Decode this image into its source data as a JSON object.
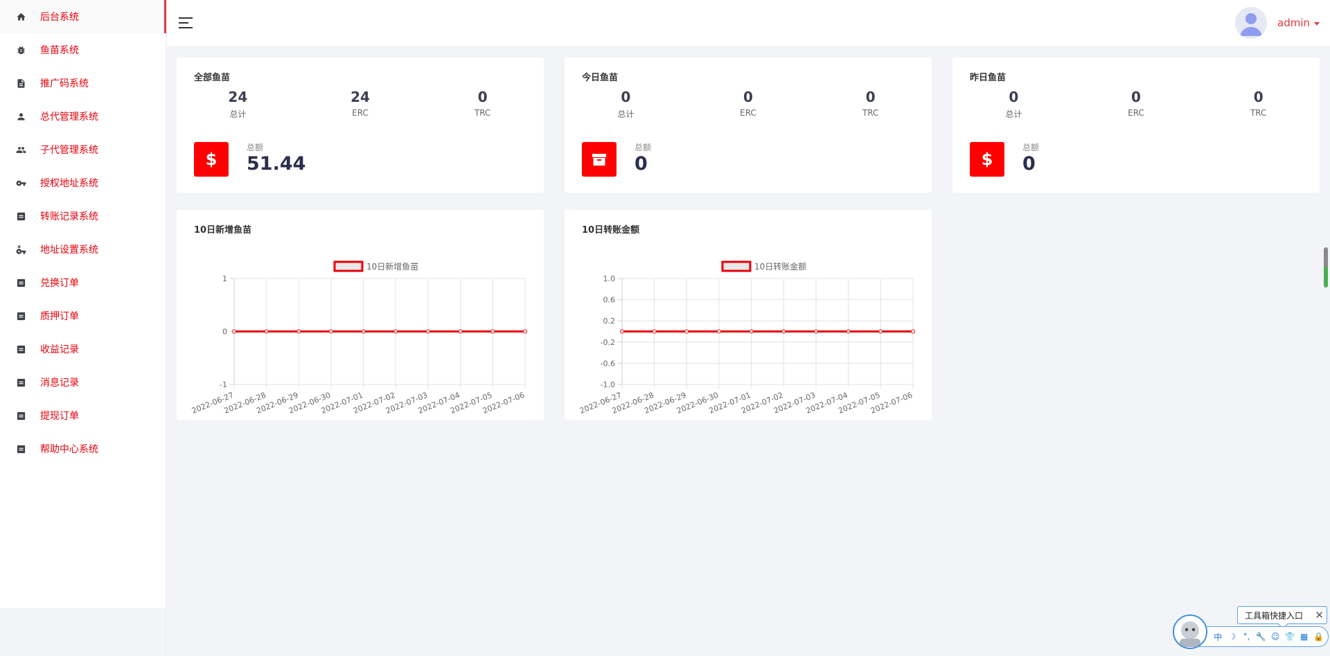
{
  "sidebar": {
    "items": [
      {
        "label": "后台系统",
        "icon": "home-icon"
      },
      {
        "label": "鱼苗系统",
        "icon": "bug-icon"
      },
      {
        "label": "推广码系统",
        "icon": "document-icon"
      },
      {
        "label": "总代管理系统",
        "icon": "user-icon"
      },
      {
        "label": "子代管理系统",
        "icon": "users-icon"
      },
      {
        "label": "授权地址系统",
        "icon": "key-icon"
      },
      {
        "label": "转账记录系统",
        "icon": "list-icon"
      },
      {
        "label": "地址设置系统",
        "icon": "key-remove-icon"
      },
      {
        "label": "兑换订单",
        "icon": "list-icon"
      },
      {
        "label": "质押订单",
        "icon": "list-icon"
      },
      {
        "label": "收益记录",
        "icon": "list-icon"
      },
      {
        "label": "消息记录",
        "icon": "list-icon"
      },
      {
        "label": "提现订单",
        "icon": "list-icon"
      },
      {
        "label": "帮助中心系统",
        "icon": "list-icon"
      }
    ]
  },
  "header": {
    "username": "admin"
  },
  "summary_cards": [
    {
      "title": "全部鱼苗",
      "stats": [
        {
          "value": "24",
          "label": "总计"
        },
        {
          "value": "24",
          "label": "ERC"
        },
        {
          "value": "0",
          "label": "TRC"
        }
      ],
      "total_label": "总额",
      "total_value": "51.44",
      "icon": "dollar-icon"
    },
    {
      "title": "今日鱼苗",
      "stats": [
        {
          "value": "0",
          "label": "总计"
        },
        {
          "value": "0",
          "label": "ERC"
        },
        {
          "value": "0",
          "label": "TRC"
        }
      ],
      "total_label": "总额",
      "total_value": "0",
      "icon": "archive-icon"
    },
    {
      "title": "昨日鱼苗",
      "stats": [
        {
          "value": "0",
          "label": "总计"
        },
        {
          "value": "0",
          "label": "ERC"
        },
        {
          "value": "0",
          "label": "TRC"
        }
      ],
      "total_label": "总额",
      "total_value": "0",
      "icon": "dollar-icon"
    }
  ],
  "chart_cards": [
    {
      "title": "10日新增鱼苗"
    },
    {
      "title": "10日转账金额"
    }
  ],
  "chart_data": [
    {
      "type": "line",
      "title": "10日新增鱼苗",
      "x": [
        "2022-06-27",
        "2022-06-28",
        "2022-06-29",
        "2022-06-30",
        "2022-07-01",
        "2022-07-02",
        "2022-07-03",
        "2022-07-04",
        "2022-07-05",
        "2022-07-06"
      ],
      "series": [
        {
          "name": "10日新增鱼苗",
          "values": [
            0,
            0,
            0,
            0,
            0,
            0,
            0,
            0,
            0,
            0
          ]
        }
      ],
      "yticks": [
        "1",
        "0",
        "-1"
      ],
      "ylim": [
        -1,
        1
      ],
      "grid": true,
      "legend": "top-center",
      "color": "#e8000b"
    },
    {
      "type": "line",
      "title": "10日转账金额",
      "x": [
        "2022-06-27",
        "2022-06-28",
        "2022-06-29",
        "2022-06-30",
        "2022-07-01",
        "2022-07-02",
        "2022-07-03",
        "2022-07-04",
        "2022-07-05",
        "2022-07-06"
      ],
      "series": [
        {
          "name": "10日转账金额",
          "values": [
            0,
            0,
            0,
            0,
            0,
            0,
            0,
            0,
            0,
            0
          ]
        }
      ],
      "yticks": [
        "1.0",
        "0.6",
        "0.2",
        "-0.2",
        "-0.6",
        "-1.0"
      ],
      "ylim": [
        -1,
        1
      ],
      "grid": true,
      "legend": "top-center",
      "color": "#e8000b"
    }
  ],
  "toolbox": {
    "tooltip": "工具箱快捷入口",
    "close": "✕",
    "items": [
      "中",
      "☽",
      "°,",
      "🔧",
      "☺",
      "👕",
      "▦",
      "🔒"
    ]
  },
  "colors": {
    "accent": "#e8000b",
    "icon_bg": "#ff0000",
    "background": "#f3f4f8"
  }
}
